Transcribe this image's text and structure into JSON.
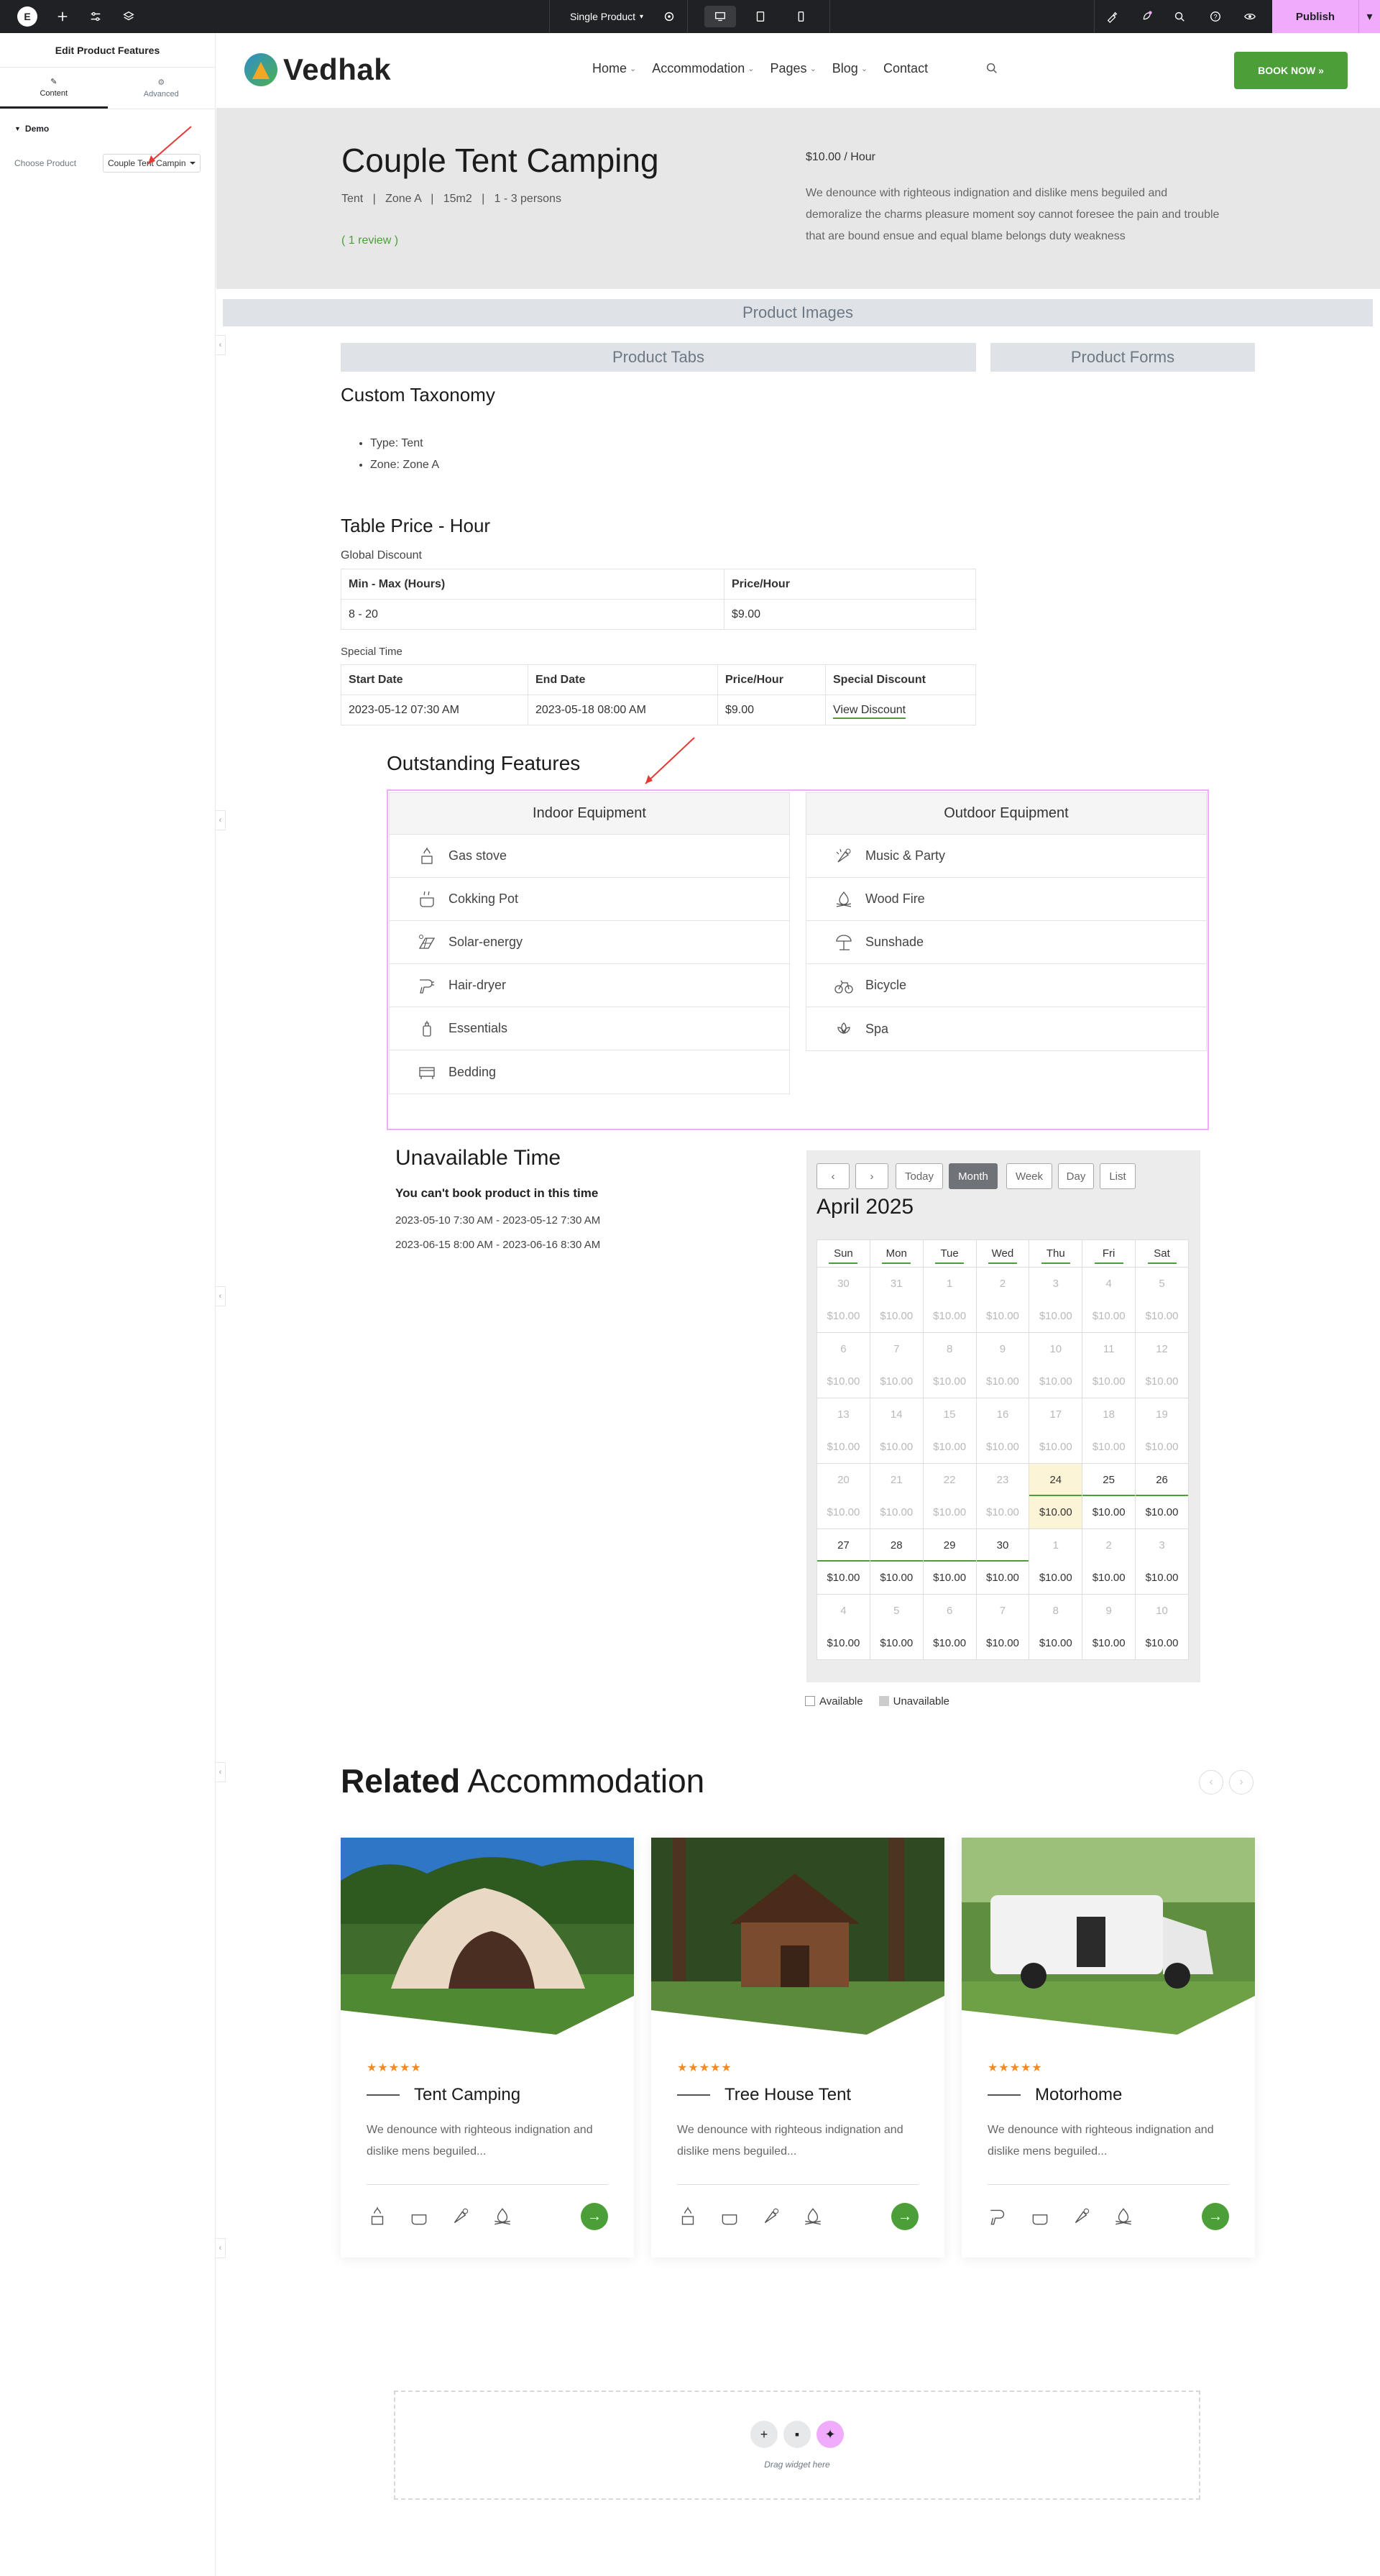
{
  "editor": {
    "doc_name": "Single Product",
    "publish_label": "Publish"
  },
  "panel": {
    "title": "Edit Product Features",
    "tabs": [
      {
        "label": "Content"
      },
      {
        "label": "Advanced"
      }
    ],
    "section": "Demo",
    "control_label": "Choose Product",
    "control_value": "Couple Tent Campin"
  },
  "header": {
    "brand": "Vedhak",
    "nav": [
      {
        "label": "Home",
        "has_dropdown": true
      },
      {
        "label": "Accommodation",
        "has_dropdown": true
      },
      {
        "label": "Pages",
        "has_dropdown": true
      },
      {
        "label": "Blog",
        "has_dropdown": true
      },
      {
        "label": "Contact",
        "has_dropdown": false
      }
    ],
    "book_label": "BOOK NOW »"
  },
  "hero": {
    "title": "Couple Tent Camping",
    "meta": "Tent   |   Zone A   |   15m2   |   1 - 3 persons",
    "review": "( 1 review )",
    "price": "$10.00 / Hour",
    "description": "We denounce with righteous indignation and dislike mens beguiled and demoralize the charms pleasure moment soy cannot foresee the pain and trouble that are bound ensue and equal blame belongs duty weakness"
  },
  "placeholders": {
    "product_images": "Product Images",
    "product_tabs": "Product Tabs",
    "product_forms": "Product Forms"
  },
  "taxonomy": {
    "title": "Custom Taxonomy",
    "items": [
      "Type: Tent",
      "Zone: Zone A"
    ]
  },
  "price_table": {
    "title": "Table Price - Hour",
    "global_label": "Global Discount",
    "global_headers": [
      "Min - Max (Hours)",
      "Price/Hour"
    ],
    "global_rows": [
      [
        "8 - 20",
        "$9.00"
      ]
    ],
    "special_label": "Special Time",
    "special_headers": [
      "Start Date",
      "End Date",
      "Price/Hour",
      "Special Discount"
    ],
    "special_rows": [
      [
        "2023-05-12 07:30 AM",
        "2023-05-18 08:00 AM",
        "$9.00",
        "View Discount"
      ]
    ]
  },
  "features": {
    "title": "Outstanding Features",
    "indoor": {
      "heading": "Indoor Equipment",
      "items": [
        {
          "label": "Gas stove",
          "icon": "gas-stove-icon"
        },
        {
          "label": "Cokking Pot",
          "icon": "cooking-pot-icon"
        },
        {
          "label": "Solar-energy",
          "icon": "solar-energy-icon"
        },
        {
          "label": "Hair-dryer",
          "icon": "hair-dryer-icon"
        },
        {
          "label": "Essentials",
          "icon": "essentials-icon"
        },
        {
          "label": "Bedding",
          "icon": "bedding-icon"
        }
      ]
    },
    "outdoor": {
      "heading": "Outdoor Equipment",
      "items": [
        {
          "label": "Music & Party",
          "icon": "music-party-icon"
        },
        {
          "label": "Wood Fire",
          "icon": "wood-fire-icon"
        },
        {
          "label": "Sunshade",
          "icon": "sunshade-icon"
        },
        {
          "label": "Bicycle",
          "icon": "bicycle-icon"
        },
        {
          "label": "Spa",
          "icon": "spa-icon"
        }
      ]
    }
  },
  "unavailable": {
    "title": "Unavailable Time",
    "subtitle": "You can't book product in this time",
    "ranges": [
      "2023-05-10 7:30 AM - 2023-05-12 7:30 AM",
      "2023-06-15 8:00 AM - 2023-06-16 8:30 AM"
    ]
  },
  "calendar": {
    "buttons": {
      "prev": "‹",
      "next": "›",
      "today": "Today",
      "month": "Month",
      "week": "Week",
      "day": "Day",
      "list": "List"
    },
    "title": "April 2025",
    "weekdays": [
      "Sun",
      "Mon",
      "Tue",
      "Wed",
      "Thu",
      "Fri",
      "Sat"
    ],
    "weeks": [
      {
        "days": [
          "30",
          "31",
          "1",
          "2",
          "3",
          "4",
          "5"
        ],
        "prices": [
          "$10.00",
          "$10.00",
          "$10.00",
          "$10.00",
          "$10.00",
          "$10.00",
          "$10.00"
        ]
      },
      {
        "days": [
          "6",
          "7",
          "8",
          "9",
          "10",
          "11",
          "12"
        ],
        "prices": [
          "$10.00",
          "$10.00",
          "$10.00",
          "$10.00",
          "$10.00",
          "$10.00",
          "$10.00"
        ]
      },
      {
        "days": [
          "13",
          "14",
          "15",
          "16",
          "17",
          "18",
          "19"
        ],
        "prices": [
          "$10.00",
          "$10.00",
          "$10.00",
          "$10.00",
          "$10.00",
          "$10.00",
          "$10.00"
        ]
      },
      {
        "days": [
          "20",
          "21",
          "22",
          "23",
          "24",
          "25",
          "26"
        ],
        "prices": [
          "$10.00",
          "$10.00",
          "$10.00",
          "$10.00",
          "$10.00",
          "$10.00",
          "$10.00"
        ]
      },
      {
        "days": [
          "27",
          "28",
          "29",
          "30",
          "1",
          "2",
          "3"
        ],
        "prices": [
          "$10.00",
          "$10.00",
          "$10.00",
          "$10.00",
          "$10.00",
          "$10.00",
          "$10.00"
        ]
      },
      {
        "days": [
          "4",
          "5",
          "6",
          "7",
          "8",
          "9",
          "10"
        ],
        "prices": [
          "$10.00",
          "$10.00",
          "$10.00",
          "$10.00",
          "$10.00",
          "$10.00",
          "$10.00"
        ]
      }
    ],
    "legend_available": "Available",
    "legend_unavailable": "Unavailable"
  },
  "related": {
    "title_bold": "Related",
    "title_light": "Accommodation",
    "cards": [
      {
        "title": "Tent Camping",
        "stars": "★★★★★",
        "description": "We denounce with righteous indignation and dislike mens beguiled..."
      },
      {
        "title": "Tree House Tent",
        "stars": "★★★★★",
        "description": "We denounce with righteous indignation and dislike mens beguiled..."
      },
      {
        "title": "Motorhome",
        "stars": "★★★★★",
        "description": "We denounce with righteous indignation and dislike mens beguiled..."
      }
    ]
  },
  "dropzone": {
    "label": "Drag widget here"
  },
  "colors": {
    "accent": "#4c9f38",
    "publish": "#f0abfc",
    "stars": "#f58a22"
  }
}
